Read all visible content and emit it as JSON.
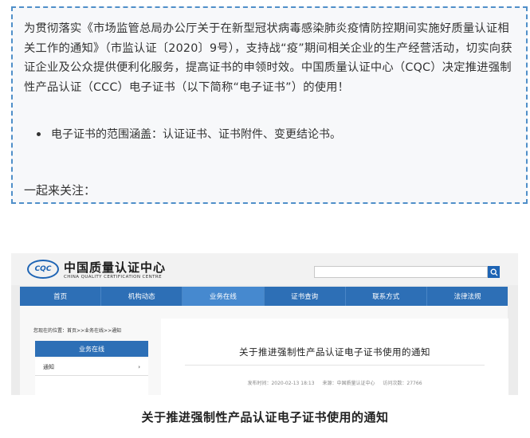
{
  "notice": {
    "paragraph": "为贯彻落实《市场监管总局办公厅关于在新型冠状病毒感染肺炎疫情防控期间实施好质量认证相关工作的通知》（市监认证〔2020〕9号），支持战“疫”期间相关企业的生产经营活动，切实向获证企业及公众提供便利化服务，提高证书的申领时效。中国质量认证中心（CQC）决定推进强制性产品认证（CCC）电子证书（以下简称“电子证书”）的使用！",
    "bullet": "电子证书的范围涵盖：认证证书、证书附件、变更结论书。",
    "follow": "一起来关注："
  },
  "site": {
    "logo_mark": "CQC",
    "logo_cn": "中国质量认证中心",
    "logo_en": "CHINA QUALITY CERTIFICATION CENTRE",
    "nav": [
      "首页",
      "机构动态",
      "业务在线",
      "证书查询",
      "联系方式",
      "法律法规"
    ],
    "active_nav": "业务在线",
    "breadcrumb": "您现在的位置：首页>>业务在线>>通知",
    "sidebar_title": "业务在线",
    "sidebar_item": "通知",
    "sidebar_chevron": "›",
    "article_title": "关于推进强制性产品认证电子证书使用的通知",
    "meta_date": "发布时间：2020-02-13 18:13",
    "meta_source": "来源：中国质量认证中心",
    "meta_views": "访问次数：27766"
  },
  "caption": "关于推进强制性产品认证电子证书使用的通知",
  "colors": {
    "accent": "#2d6fb6",
    "border": "#4f8fc9"
  },
  "icons": {
    "search": "search-icon"
  }
}
